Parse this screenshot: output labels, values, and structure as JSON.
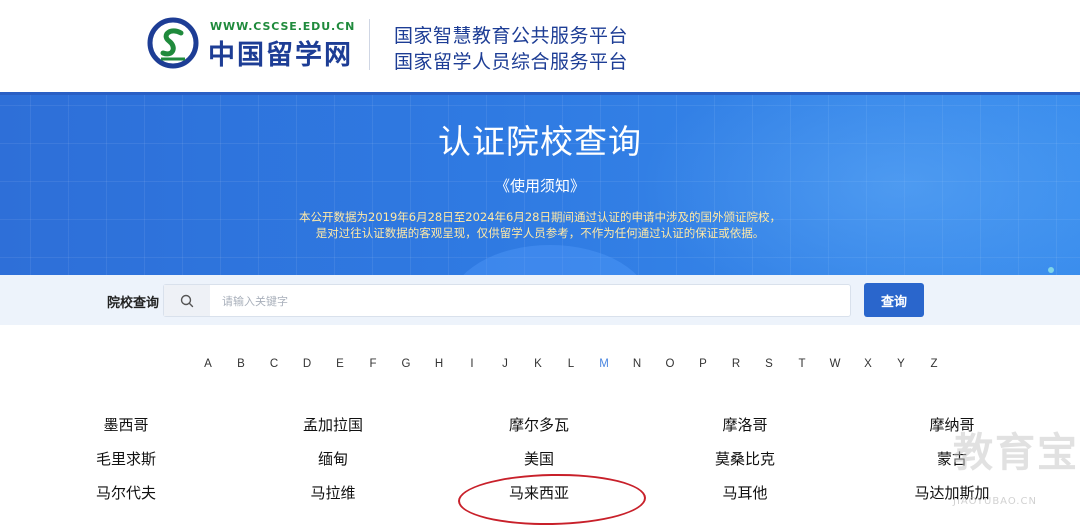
{
  "header": {
    "logo_url": "WWW.CSCSE.EDU.CN",
    "logo_name": "中国留学网",
    "platform_line1": "国家智慧教育公共服务平台",
    "platform_line2": "国家留学人员综合服务平台"
  },
  "banner": {
    "title": "认证院校查询",
    "notice_link": "《使用须知》",
    "desc_line1": "本公开数据为2019年6月28日至2024年6月28日期间通过认证的申请中涉及的国外颁证院校，",
    "desc_line2": "是对过往认证数据的客观呈现，仅供留学人员参考，不作为任何通过认证的保证或依据。"
  },
  "search": {
    "label": "院校查询",
    "placeholder": "请输入关键字",
    "value": "",
    "button": "查询",
    "icon": "search-icon"
  },
  "alphabet": {
    "letters": [
      "A",
      "B",
      "C",
      "D",
      "E",
      "F",
      "G",
      "H",
      "I",
      "J",
      "K",
      "L",
      "M",
      "N",
      "O",
      "P",
      "R",
      "S",
      "T",
      "W",
      "X",
      "Y",
      "Z"
    ],
    "active": "M"
  },
  "schools": [
    [
      "墨西哥",
      "孟加拉国",
      "摩尔多瓦",
      "摩洛哥",
      "摩纳哥"
    ],
    [
      "毛里求斯",
      "缅甸",
      "美国",
      "莫桑比克",
      "蒙古"
    ],
    [
      "马尔代夫",
      "马拉维",
      "马来西亚",
      "马耳他",
      "马达加斯加"
    ]
  ],
  "annotation": {
    "highlighted": "马来西亚",
    "color": "#c8202a"
  },
  "watermark": {
    "text": "教育宝",
    "sub": "JIAOYUBAO.CN"
  },
  "colors": {
    "brand_blue": "#1d3d95",
    "button_blue": "#2a66cc",
    "banner_blue": "#2f7ae2",
    "active_letter": "#4a86e0"
  }
}
